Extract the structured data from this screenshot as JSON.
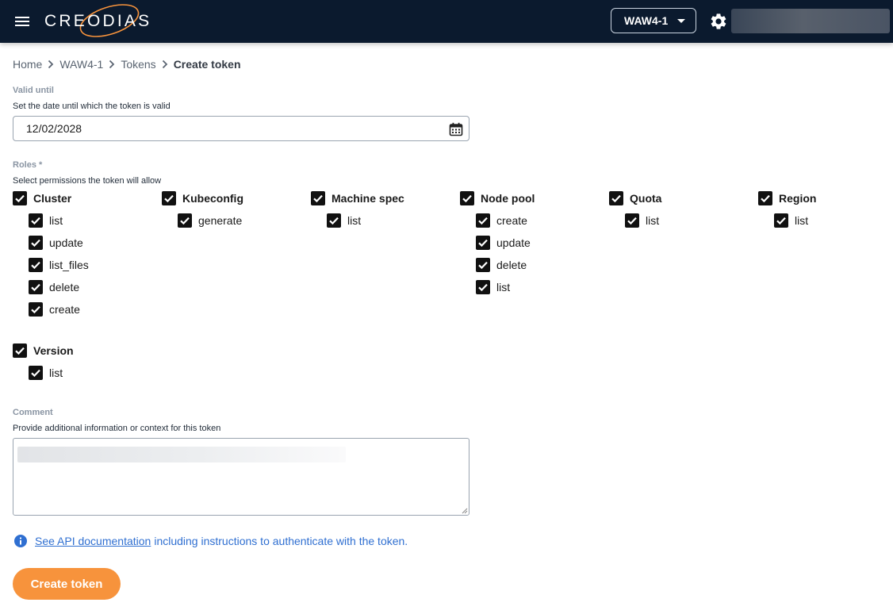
{
  "header": {
    "logo_text": "CREODIAS",
    "region": "WAW4-1",
    "colors": {
      "background": "#0b1a2e",
      "logo_accent": "#f7933c"
    }
  },
  "breadcrumb": [
    "Home",
    "WAW4-1",
    "Tokens",
    "Create token"
  ],
  "valid_until": {
    "label": "Valid until",
    "help": "Set the date until which the token is valid",
    "value": "12/02/2028"
  },
  "roles": {
    "label": "Roles *",
    "help": "Select permissions the token will allow",
    "groups": [
      {
        "name": "Cluster",
        "checked": true,
        "items": [
          "list",
          "update",
          "list_files",
          "delete",
          "create"
        ]
      },
      {
        "name": "Kubeconfig",
        "checked": true,
        "items": [
          "generate"
        ]
      },
      {
        "name": "Machine spec",
        "checked": true,
        "items": [
          "list"
        ]
      },
      {
        "name": "Node pool",
        "checked": true,
        "items": [
          "create",
          "update",
          "delete",
          "list"
        ]
      },
      {
        "name": "Quota",
        "checked": true,
        "items": [
          "list"
        ]
      },
      {
        "name": "Region",
        "checked": true,
        "items": [
          "list"
        ]
      },
      {
        "name": "Version",
        "checked": true,
        "items": [
          "list"
        ]
      }
    ]
  },
  "comment": {
    "label": "Comment",
    "help": "Provide additional information or context for this token",
    "value": ""
  },
  "api_note": {
    "link": "See API documentation",
    "text": "including instructions to authenticate with the token."
  },
  "create_button": "Create token",
  "accent_color": "#f7933c",
  "link_color": "#2f6fd1"
}
